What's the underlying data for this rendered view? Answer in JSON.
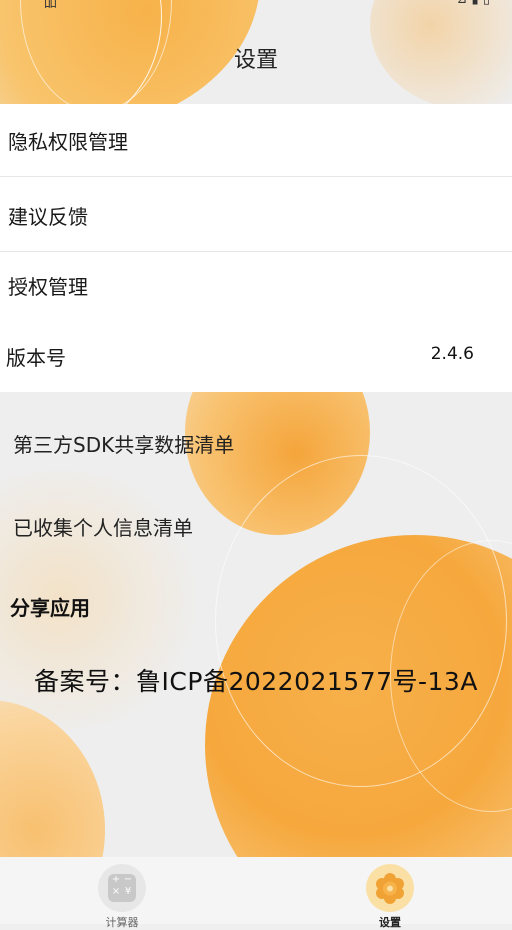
{
  "status_bar": {
    "left": "吅",
    "right": "⊿ ▮ ▯"
  },
  "header": {
    "title": "设置"
  },
  "settings_list": [
    {
      "label": "隐私权限管理"
    },
    {
      "label": "建议反馈"
    },
    {
      "label": "授权管理"
    },
    {
      "label": "版本号",
      "value": "2.4.6"
    }
  ],
  "links": {
    "sdk_list": "第三方SDK共享数据清单",
    "collected_info": "已收集个人信息清单",
    "share_app": "分享应用"
  },
  "icp": "备案号：鲁ICP备2022021577号-13A",
  "nav": {
    "calculator": {
      "label": "计算器",
      "icon": "calculator-icon"
    },
    "settings": {
      "label": "设置",
      "icon": "gear-icon",
      "active": true
    }
  },
  "colors": {
    "accent": "#f6a83d",
    "nav_active_bg": "#fbe0a6"
  }
}
